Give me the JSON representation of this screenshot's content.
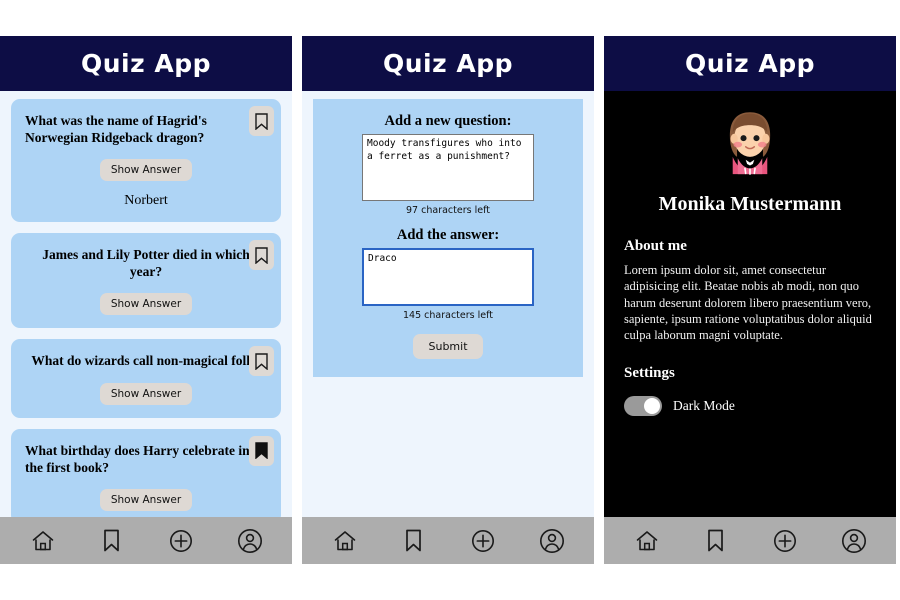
{
  "app": {
    "title": "Quiz App",
    "accent_header": "#0d0d45",
    "card_color": "#aed4f5",
    "page_bg": "#eef5fd",
    "nav_bg": "#adadad",
    "button_bg": "#ded9d4",
    "focus_border": "#2a64c4"
  },
  "screens": [
    {
      "name": "questions-list",
      "header_title": "Quiz App",
      "cards": [
        {
          "question": "What was the name of Hagrid's Norwegian Ridgeback dragon?",
          "show_answer_label": "Show Answer",
          "answer": "Norbert",
          "answer_visible": true,
          "bookmarked": false,
          "bookmark_icon": "bookmark-outline-icon"
        },
        {
          "question": "James and Lily Potter died in which year?",
          "show_answer_label": "Show Answer",
          "answer": "",
          "answer_visible": false,
          "bookmarked": false,
          "bookmark_icon": "bookmark-outline-icon"
        },
        {
          "question": "What do wizards call non-magical folk?",
          "show_answer_label": "Show Answer",
          "answer": "",
          "answer_visible": false,
          "bookmarked": false,
          "bookmark_icon": "bookmark-outline-icon"
        },
        {
          "question": "What birthday does Harry celebrate in the first book?",
          "show_answer_label": "Show Answer",
          "answer": "",
          "answer_visible": false,
          "bookmarked": true,
          "bookmark_icon": "bookmark-filled-icon"
        }
      ]
    },
    {
      "name": "add-question",
      "header_title": "Quiz App",
      "form": {
        "question_label": "Add a new question:",
        "question_value": "Moody transfigures who into a ferret as a punishment?",
        "question_chars_left": "97 characters left",
        "answer_label": "Add the answer:",
        "answer_value": "Draco",
        "answer_chars_left": "145 characters left",
        "submit_label": "Submit"
      }
    },
    {
      "name": "profile",
      "header_title": "Quiz App",
      "profile": {
        "avatar_icon": "woman-avatar-icon",
        "name": "Monika Mustermann",
        "about_heading": "About me",
        "about_text": "Lorem ipsum dolor sit, amet consectetur adipisicing elit. Beatae nobis ab modi, non quo harum deserunt dolorem libero praesentium vero, sapiente, ipsum ratione voluptatibus dolor aliquid culpa laborum magni voluptate.",
        "settings_heading": "Settings",
        "dark_mode_label": "Dark Mode",
        "dark_mode_on": true
      }
    }
  ],
  "nav": {
    "items": [
      {
        "icon": "home-icon",
        "name": "nav-home"
      },
      {
        "icon": "bookmark-icon",
        "name": "nav-bookmarks"
      },
      {
        "icon": "plus-circle-icon",
        "name": "nav-add"
      },
      {
        "icon": "person-circle-icon",
        "name": "nav-profile"
      }
    ]
  }
}
